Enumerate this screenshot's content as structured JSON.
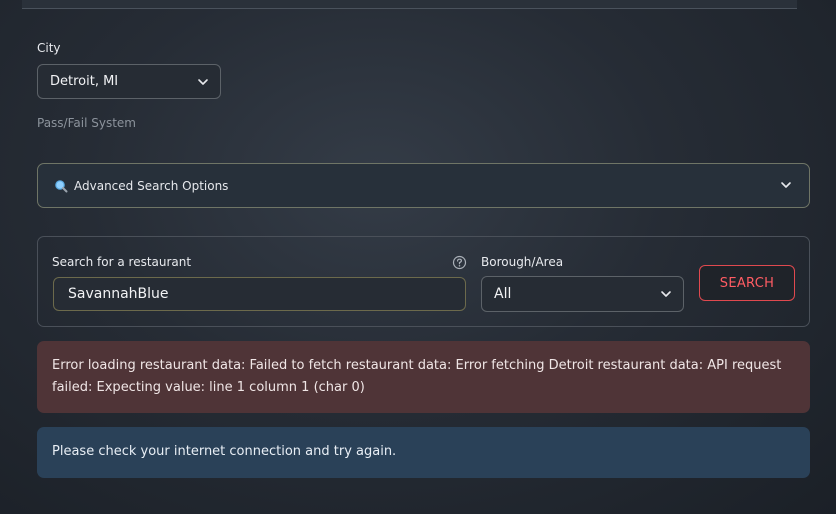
{
  "city": {
    "label": "City",
    "selected": "Detroit, MI"
  },
  "pass_fail_text": "Pass/Fail System",
  "advanced": {
    "label": "Advanced Search Options"
  },
  "search": {
    "label": "Search for a restaurant",
    "value": "SavannahBlue"
  },
  "borough": {
    "label": "Borough/Area",
    "selected": "All"
  },
  "search_button": "SEARCH",
  "error_message": "Error loading restaurant data: Failed to fetch restaurant data: Error fetching Detroit restaurant data: API request failed: Expecting value: line 1 column 1 (char 0)",
  "info_message": "Please check your internet connection and try again.",
  "colors": {
    "accent": "#ff5c63",
    "error_bg": "#4f3437",
    "info_bg": "#2a4158"
  }
}
